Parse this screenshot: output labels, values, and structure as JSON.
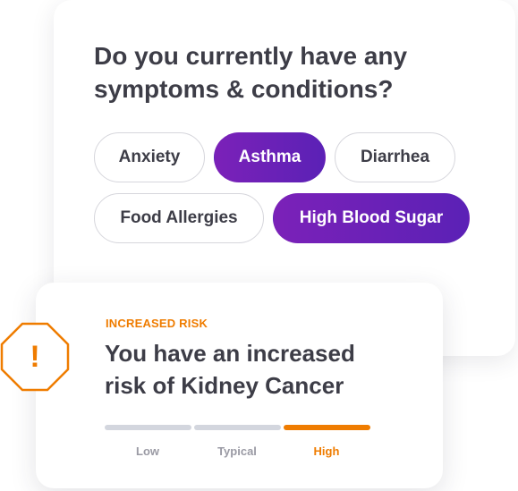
{
  "question": "Do you currently have any symptoms & conditions?",
  "options": [
    {
      "label": "Anxiety",
      "selected": false
    },
    {
      "label": "Asthma",
      "selected": true
    },
    {
      "label": "Diarrhea",
      "selected": false
    },
    {
      "label": "Food Allergies",
      "selected": false
    },
    {
      "label": "High Blood Sugar",
      "selected": true
    }
  ],
  "risk": {
    "label": "INCREASED RISK",
    "title": "You have an increased risk of Kidney Cancer",
    "warning_icon": "warning-octagon-icon",
    "warning_mark": "!",
    "level": "High",
    "scale": [
      {
        "label": "Low"
      },
      {
        "label": "Typical"
      },
      {
        "label": "High"
      }
    ]
  },
  "colors": {
    "chip_selected_a": "#7b21b8",
    "chip_selected_b": "#5b21b6",
    "risk_orange": "#ef7c00",
    "scale_gray": "#d3d6de",
    "scale_label": "#9a9aa4",
    "text_dark": "#3d3d47"
  }
}
